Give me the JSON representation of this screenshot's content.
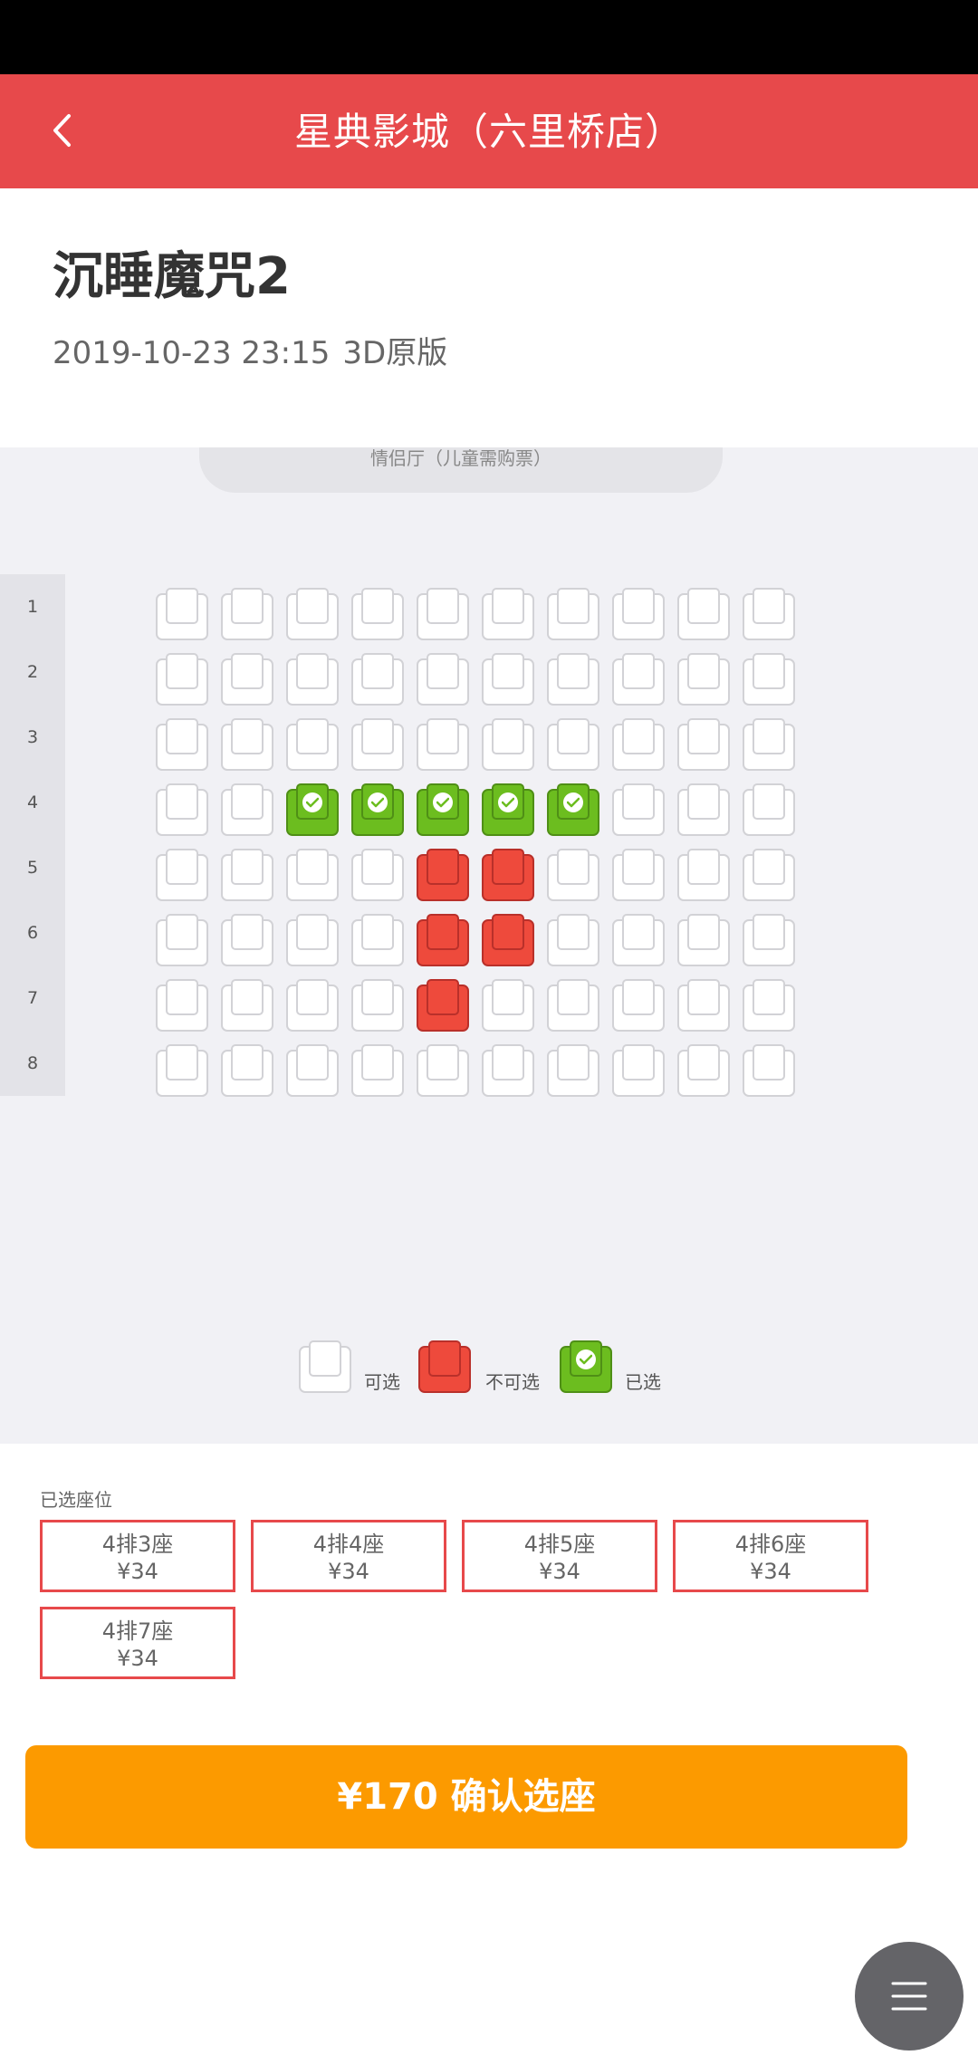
{
  "app": {
    "header_title": "星典影城（六里桥店）",
    "back_icon": "chevron-left-icon",
    "menu_icon": "menu-icon"
  },
  "movie": {
    "title": "沉睡魔咒2",
    "datetime": "2019-10-23 23:15",
    "format": "3D原版"
  },
  "hall": {
    "screen_label": "情侣厅（儿童需购票）",
    "rows": [
      "1",
      "2",
      "3",
      "4",
      "5",
      "6",
      "7",
      "8"
    ],
    "seats_per_row": 10,
    "selected_seats": [
      [
        4,
        3
      ],
      [
        4,
        4
      ],
      [
        4,
        5
      ],
      [
        4,
        6
      ],
      [
        4,
        7
      ]
    ],
    "sold_seats": [
      [
        5,
        5
      ],
      [
        5,
        6
      ],
      [
        6,
        5
      ],
      [
        6,
        6
      ],
      [
        7,
        5
      ]
    ]
  },
  "legend": {
    "available": "可选",
    "sold": "不可选",
    "selected": "已选"
  },
  "selection": {
    "heading": "已选座位",
    "tickets": [
      {
        "seat": "4排3座",
        "price": "¥34"
      },
      {
        "seat": "4排4座",
        "price": "¥34"
      },
      {
        "seat": "4排5座",
        "price": "¥34"
      },
      {
        "seat": "4排6座",
        "price": "¥34"
      },
      {
        "seat": "4排7座",
        "price": "¥34"
      }
    ]
  },
  "confirm": {
    "label": "¥170 确认选座"
  },
  "colors": {
    "header": "#e7494b",
    "sold": "#ee4a3c",
    "selected": "#6cbd1f",
    "confirm": "#fc9a00"
  }
}
